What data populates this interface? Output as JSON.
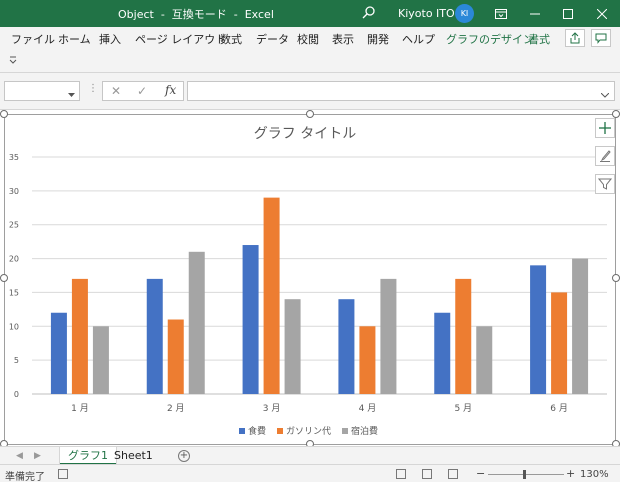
{
  "window": {
    "title": "Object  -  互換モード  -  Excel",
    "user_name": "Kiyoto ITO",
    "user_initials": "KI"
  },
  "ribbon": {
    "tabs": [
      "ファイル",
      "ホーム",
      "挿入",
      "ページ レイアウト",
      "数式",
      "データ",
      "校閲",
      "表示",
      "開発",
      "ヘルプ"
    ],
    "context_tabs": [
      "グラフのデザイン",
      "書式"
    ]
  },
  "formula_bar": {
    "name_box": "",
    "fx_label": "fx",
    "formula": ""
  },
  "chart_data": {
    "type": "bar",
    "title": "グラフ タイトル",
    "categories": [
      "1 月",
      "2 月",
      "3 月",
      "4 月",
      "5 月",
      "6 月"
    ],
    "series": [
      {
        "name": "食費",
        "color": "#4472C4",
        "values": [
          12,
          17,
          22,
          14,
          12,
          19
        ]
      },
      {
        "name": "ガソリン代",
        "color": "#ED7D31",
        "values": [
          17,
          11,
          29,
          10,
          17,
          15
        ]
      },
      {
        "name": "宿泊費",
        "color": "#A5A5A5",
        "values": [
          10,
          21,
          14,
          17,
          10,
          20
        ]
      }
    ],
    "ylim": [
      0,
      35
    ],
    "yticks": [
      0,
      5,
      10,
      15,
      20,
      25,
      30,
      35
    ],
    "grid": true,
    "legend": "bottom"
  },
  "sheets": {
    "tabs": [
      "グラフ1",
      "Sheet1"
    ],
    "active": "グラフ1"
  },
  "status": {
    "ready": "準備完了",
    "zoom": "130%"
  },
  "colors": {
    "excel_green": "#217346"
  }
}
